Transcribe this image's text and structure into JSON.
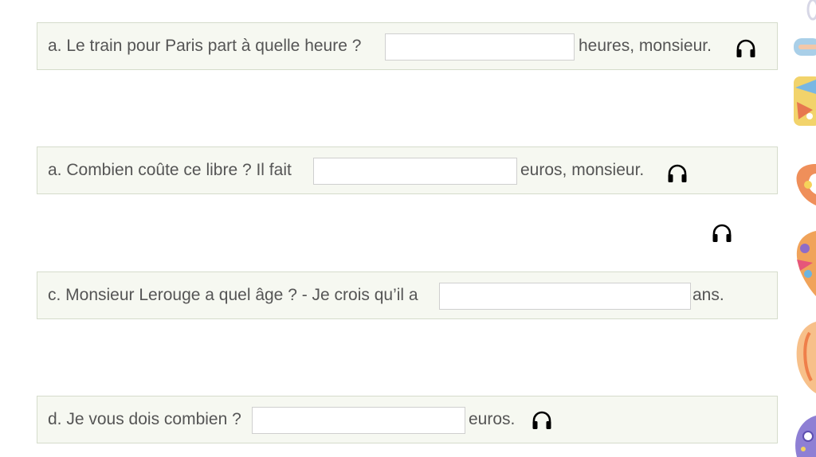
{
  "questions": [
    {
      "question": "a. Le train pour Paris part à quelle heure ?",
      "answer": "",
      "suffix": "heures, monsieur."
    },
    {
      "question": "a. Combien coûte ce libre ? Il fait",
      "answer": "",
      "suffix": "euros, monsieur."
    },
    {
      "question": "c. Monsieur Lerouge a quel âge ? - Je crois qu’il a",
      "answer": "",
      "suffix": "ans."
    },
    {
      "question": "d. Je vous dois combien ?",
      "answer": "",
      "suffix": "euros."
    }
  ],
  "icons": {
    "audio": "headphones-icon",
    "decoration": "colorful-letters"
  },
  "colors": {
    "card_bg": "#f6f8f1",
    "card_border": "#d5dccb",
    "text": "#555555"
  }
}
